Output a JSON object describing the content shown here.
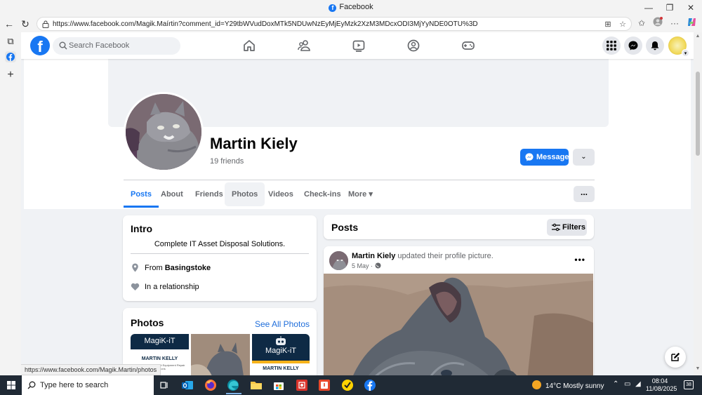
{
  "window": {
    "title": "Facebook",
    "url": "https://www.facebook.com/Magik.Maírtin?comment_id=Y29tbWVudDoxMTk5NDUwNzEyMjEyMzk2XzM3MDcxODI3MjYyNDE0OTU%3D",
    "status_url": "https://www.facebook.com/Magik.Martin/photos"
  },
  "fb_nav": {
    "logo": "f",
    "search_placeholder": "Search Facebook"
  },
  "profile": {
    "name": "Martin Kiely",
    "friends": "19 friends",
    "message_label": "Message",
    "dropdown_glyph": "⌄",
    "tabs": [
      "Posts",
      "About",
      "Friends",
      "Photos",
      "Videos",
      "Check-ins",
      "More ▾"
    ],
    "more_dots": "..."
  },
  "intro": {
    "title": "Intro",
    "bio": "Complete IT Asset Disposal Solutions.",
    "from_prefix": "From ",
    "from_place": "Basingstoke",
    "relationship": "In a relationship"
  },
  "photos": {
    "title": "Photos",
    "see_all": "See All Photos",
    "thumb1_title": "MagiK-iT",
    "thumb1_sub": "MARTIN KELLY",
    "thumb1_small": "Technology Sales and Equipment Repair Solutions",
    "thumb3_title": "MagiK-iT",
    "thumb3_sub": "MARTIN KELLY"
  },
  "posts": {
    "title": "Posts",
    "filters_label": "Filters",
    "post_author": "Martin Kiely",
    "post_action": " updated their profile picture.",
    "post_date": "5 May · ",
    "post_more": "•••"
  },
  "taskbar": {
    "search_placeholder": "Type here to search",
    "weather": "14°C  Mostly sunny",
    "time": "08:04",
    "date": "11/08/2025",
    "notifications": "38"
  },
  "colors": {
    "fb_blue": "#1877f2",
    "link_blue": "#216fdb",
    "page_bg": "#f0f2f5",
    "taskbar_bg": "#202a35"
  },
  "icons": [
    "home-icon",
    "friends-icon",
    "video-icon",
    "groups-icon",
    "gaming-icon",
    "menu-grid-icon",
    "messenger-icon",
    "bell-icon",
    "location-pin-icon",
    "heart-icon",
    "filters-icon",
    "compose-icon",
    "globe-icon"
  ]
}
